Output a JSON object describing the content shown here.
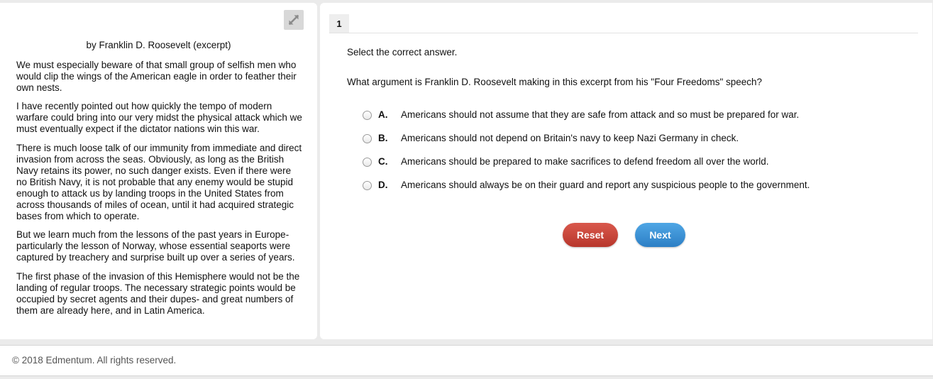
{
  "passage": {
    "byline": "by Franklin D. Roosevelt (excerpt)",
    "paragraphs": [
      "We must especially beware of that small group of selfish men who would clip the wings of the American eagle in order to feather their own nests.",
      "I have recently pointed out how quickly the tempo of modern warfare could bring into our very midst the physical attack which we must eventually expect if the dictator nations win this war.",
      "There is much loose talk of our immunity from immediate and direct invasion from across the seas. Obviously, as long as the British Navy retains its power, no such danger exists. Even if there were no British Navy, it is not probable that any enemy would be stupid enough to attack us by landing troops in the United States from across thousands of miles of ocean, until it had acquired strategic bases from which to operate.",
      "But we learn much from the lessons of the past years in Europe- particularly the lesson of Norway, whose essential seaports were captured by treachery and surprise built up over a series of years.",
      "The first phase of the invasion of this Hemisphere would not be the landing of regular troops. The necessary strategic points would be occupied by secret agents and their dupes- and great numbers of them are already here, and in Latin America."
    ],
    "expand_icon": "expand-arrows-icon"
  },
  "question": {
    "number": "1",
    "instruction": "Select the correct answer.",
    "prompt": "What argument is Franklin D. Roosevelt making in this excerpt from his \"Four Freedoms\" speech?",
    "choices": [
      {
        "letter": "A.",
        "text": "Americans should not assume that they are safe from attack and so must be prepared for war."
      },
      {
        "letter": "B.",
        "text": "Americans should not depend on Britain's navy to keep Nazi Germany in check."
      },
      {
        "letter": "C.",
        "text": "Americans should be prepared to make sacrifices to defend freedom all over the world."
      },
      {
        "letter": "D.",
        "text": "Americans should always be on their guard and report any suspicious people to the government."
      }
    ]
  },
  "actions": {
    "reset_label": "Reset",
    "next_label": "Next",
    "reset_color": "#c9473b",
    "next_color": "#3a8fd4"
  },
  "footer": {
    "copyright": "© 2018 Edmentum. All rights reserved."
  }
}
